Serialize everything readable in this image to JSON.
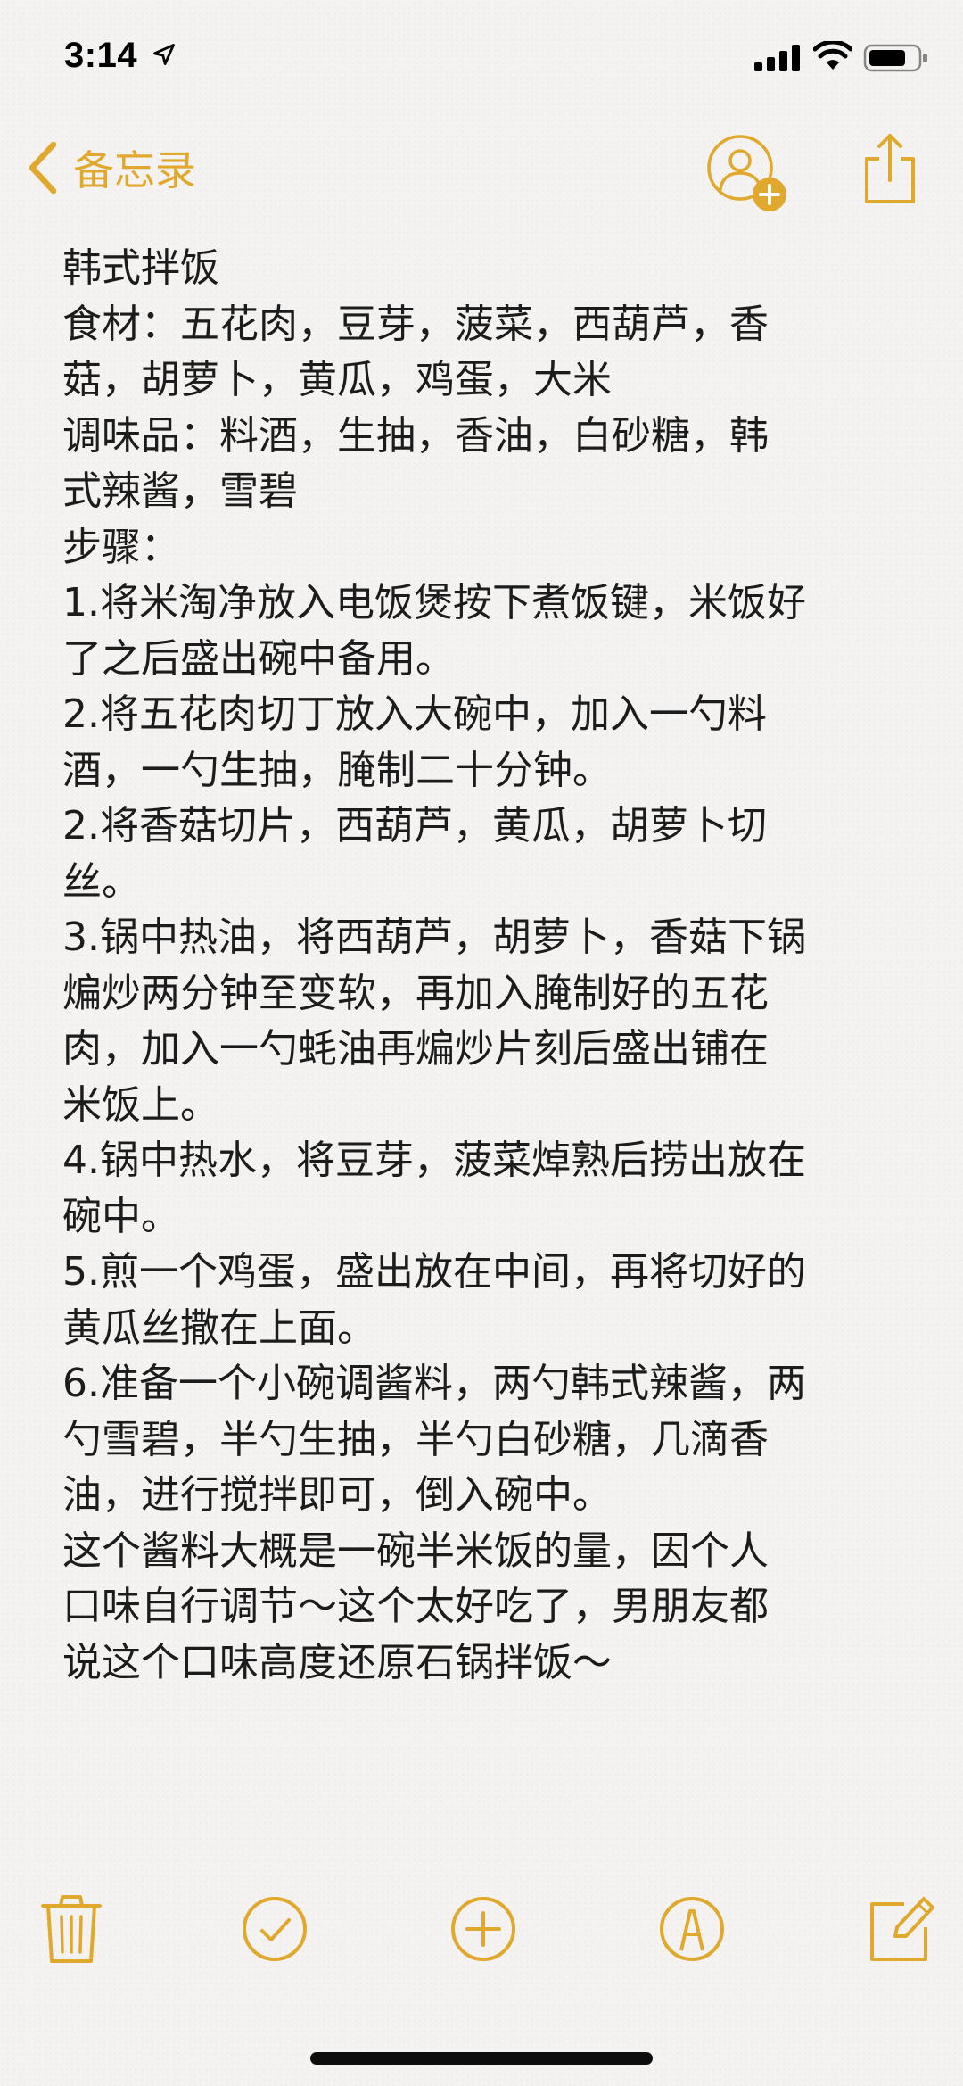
{
  "status_bar": {
    "time": "3:14",
    "icons": [
      "location-arrow-icon",
      "cellular-signal-icon",
      "wifi-icon",
      "battery-icon"
    ]
  },
  "nav": {
    "back_label": "备忘录",
    "icons": [
      "chevron-left-icon",
      "add-person-icon",
      "share-icon"
    ]
  },
  "note": {
    "title": "韩式拌饭",
    "lines": [
      "韩式拌饭",
      "食材：五花肉，豆芽，菠菜，西葫芦，香",
      "菇，胡萝卜，黄瓜，鸡蛋，大米",
      "调味品：料酒，生抽，香油，白砂糖，韩",
      "式辣酱，雪碧",
      "步骤：",
      "1.将米淘净放入电饭煲按下煮饭键，米饭好",
      "了之后盛出碗中备用。",
      "2.将五花肉切丁放入大碗中，加入一勺料",
      "酒，一勺生抽，腌制二十分钟。",
      "2.将香菇切片，西葫芦，黄瓜，胡萝卜切",
      "丝。",
      "3.锅中热油，将西葫芦，胡萝卜，香菇下锅",
      "煸炒两分钟至变软，再加入腌制好的五花",
      "肉，加入一勺蚝油再煸炒片刻后盛出铺在",
      "米饭上。",
      "4.锅中热水，将豆芽，菠菜焯熟后捞出放在",
      "碗中。",
      "5.煎一个鸡蛋，盛出放在中间，再将切好的",
      "黄瓜丝撒在上面。",
      "6.准备一个小碗调酱料，两勺韩式辣酱，两",
      "勺雪碧，半勺生抽，半勺白砂糖，几滴香",
      "油，进行搅拌即可，倒入碗中。",
      "这个酱料大概是一碗半米饭的量，因个人",
      "口味自行调节～这个太好吃了，男朋友都",
      "说这个口味高度还原石锅拌饭～"
    ]
  },
  "toolbar": {
    "icons": [
      "trash-icon",
      "checklist-icon",
      "add-icon",
      "markup-icon",
      "compose-icon"
    ]
  },
  "colors": {
    "accent": "#e1a82e",
    "background": "#f4f3f1",
    "text": "#1c1c1c"
  }
}
